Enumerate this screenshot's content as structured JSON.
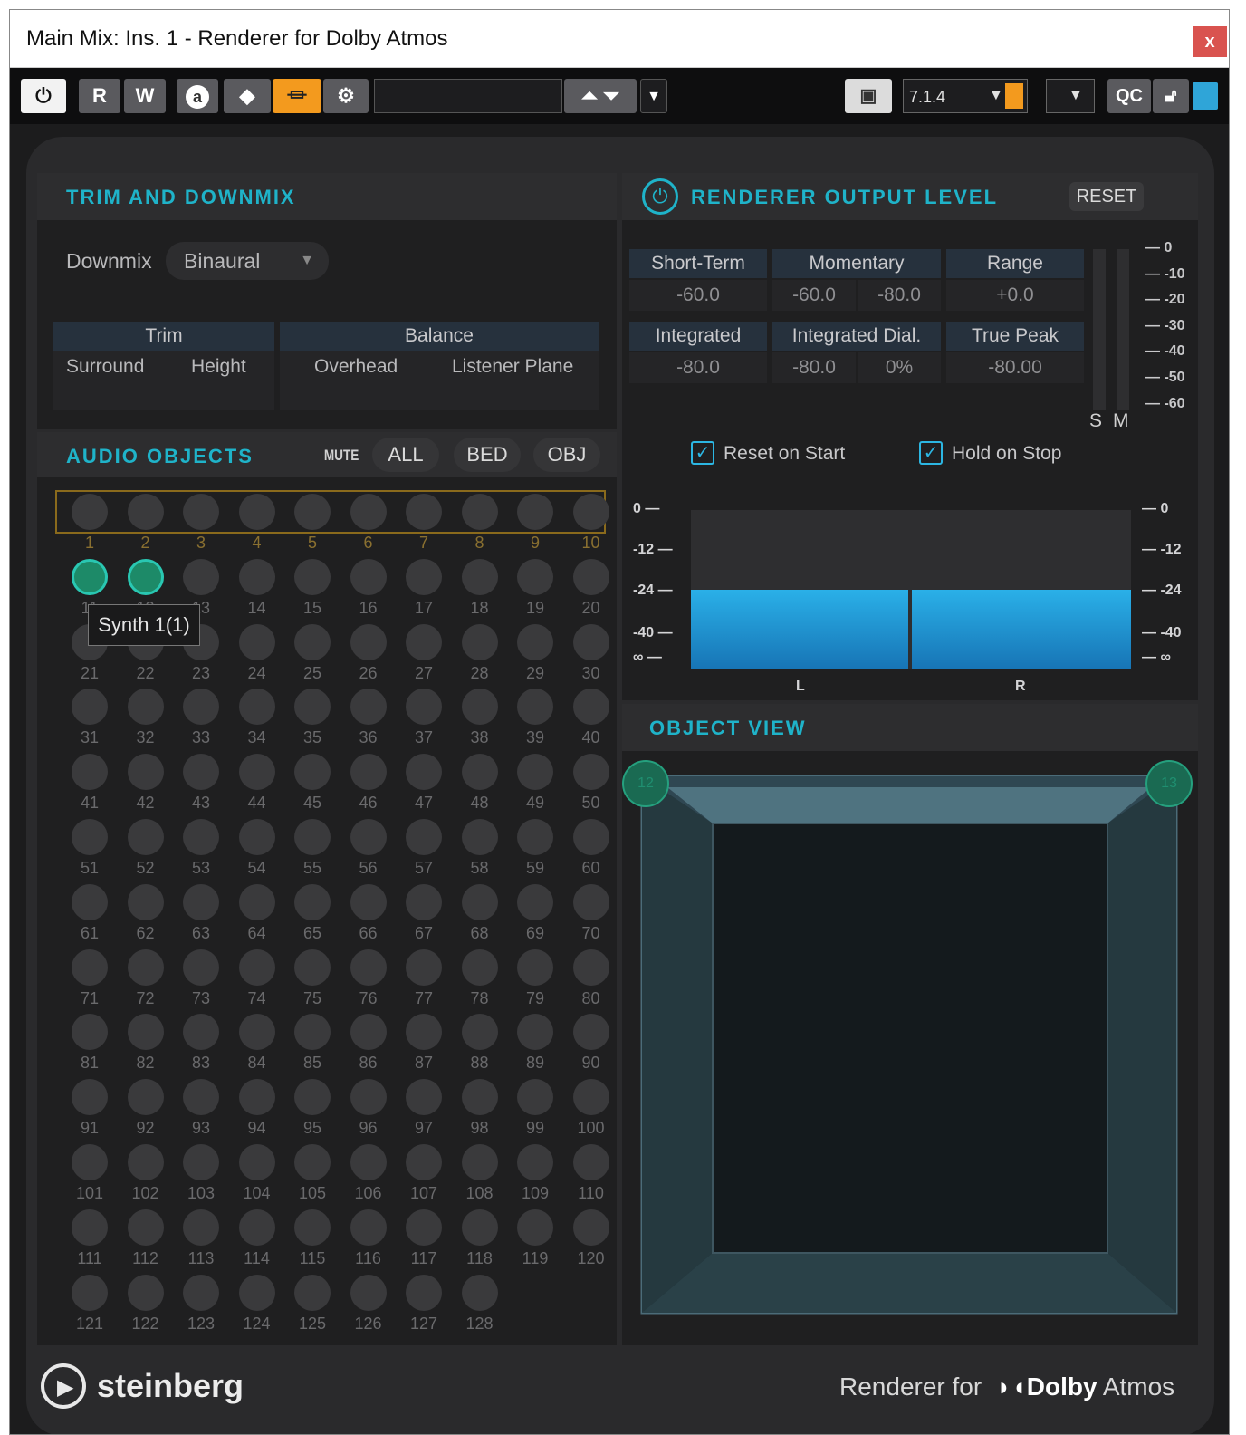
{
  "window": {
    "title": "Main Mix: Ins. 1 - Renderer for Dolby Atmos",
    "close_label": "x"
  },
  "toolbar": {
    "read_label": "R",
    "write_label": "W",
    "a_label": "a",
    "format_value": "7.1.4",
    "qc_label": "QC"
  },
  "trim": {
    "title": "TRIM AND DOWNMIX",
    "downmix_label": "Downmix",
    "downmix_value": "Binaural",
    "trim_header": "Trim",
    "balance_header": "Balance",
    "surround": "Surround",
    "height": "Height",
    "overhead": "Overhead",
    "listener_plane": "Listener Plane"
  },
  "objects": {
    "title": "AUDIO OBJECTS",
    "mute_label": "MUTE",
    "all_label": "ALL",
    "bed_label": "BED",
    "obj_label": "OBJ",
    "tooltip": "Synth 1(1)",
    "count": 128,
    "active": [
      11,
      12
    ]
  },
  "renderer": {
    "title": "RENDERER OUTPUT LEVEL",
    "reset_label": "RESET",
    "short_term_label": "Short-Term",
    "momentary_label": "Momentary",
    "range_label": "Range",
    "short_term_value": "-60.0",
    "momentary_value_1": "-60.0",
    "momentary_value_2": "-80.0",
    "range_value": "+0.0",
    "integrated_label": "Integrated",
    "integrated_dial_label": "Integrated Dial.",
    "true_peak_label": "True Peak",
    "integrated_value": "-80.0",
    "integrated_dial_value": "-80.0",
    "integrated_dial_pct": "0%",
    "true_peak_value": "-80.00",
    "loudness_ticks": [
      "0",
      "-10",
      "-20",
      "-30",
      "-40",
      "-50",
      "-60"
    ],
    "s_label": "S",
    "m_label": "M",
    "reset_on_start": "Reset on Start",
    "hold_on_stop": "Hold on Stop",
    "meter_ticks": [
      "0",
      "-12",
      "-24",
      "-40",
      "∞"
    ],
    "channel_l": "L",
    "channel_r": "R",
    "level_l_db": -24,
    "level_r_db": -24
  },
  "object_view": {
    "title": "OBJECT VIEW",
    "node_left": "12",
    "node_right": "13"
  },
  "footer": {
    "brand": "steinberg",
    "product_prefix": "Renderer for",
    "dolby": "Dolby",
    "atmos": "Atmos"
  }
}
